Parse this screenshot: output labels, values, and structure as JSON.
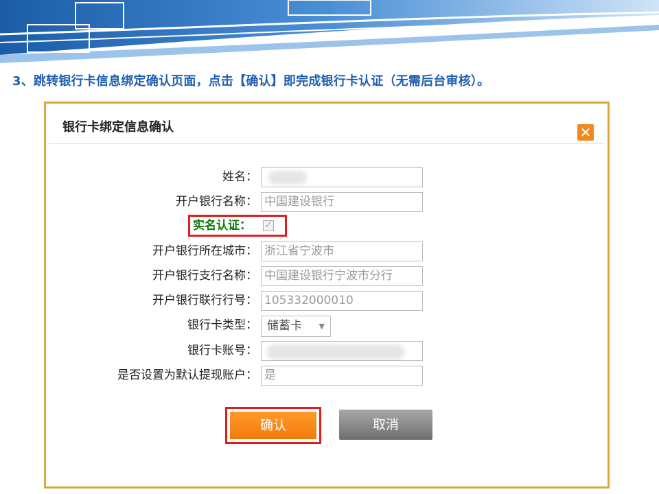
{
  "instruction": "3、跳转银行卡信息绑定确认页面，点击【确认】即完成银行卡认证（无需后台审核）。",
  "dialog": {
    "title": "银行卡绑定信息确认",
    "close_icon": "close-icon",
    "fields": {
      "name": {
        "label": "姓名：",
        "value": ""
      },
      "bank_name": {
        "label": "开户银行名称：",
        "value": "中国建设银行"
      },
      "realname": {
        "label": "实名认证：",
        "checked": true
      },
      "city": {
        "label": "开户银行所在城市：",
        "value": "浙江省宁波市"
      },
      "branch": {
        "label": "开户银行支行名称：",
        "value": "中国建设银行宁波市分行"
      },
      "union_no": {
        "label": "开户银行联行行号：",
        "value": "105332000010"
      },
      "card_type": {
        "label": "银行卡类型：",
        "value": "储蓄卡"
      },
      "card_no": {
        "label": "银行卡账号：",
        "value": ""
      },
      "default_withdraw": {
        "label": "是否设置为默认提现账户：",
        "value": "是"
      }
    },
    "buttons": {
      "confirm": "确认",
      "cancel": "取消"
    }
  },
  "colors": {
    "instruction": "#1f5fb0",
    "highlight": "#e01e1e",
    "confirm": "#f7870f",
    "realname_label": "#0a7a0a",
    "dialog_border": "#d8a93a"
  }
}
